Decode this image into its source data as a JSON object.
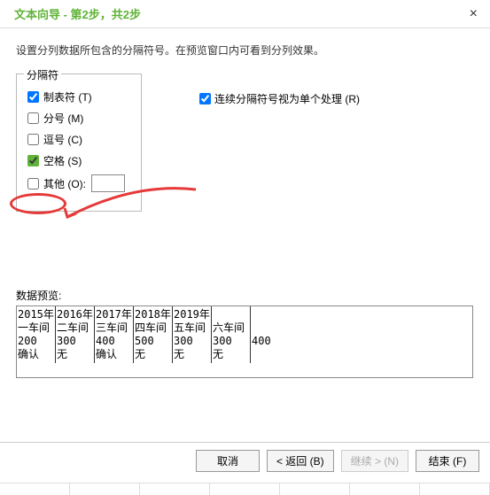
{
  "header": {
    "title": "文本向导 - 第2步，共2步",
    "close": "×"
  },
  "instruction": "设置分列数据所包含的分隔符号。在预览窗口内可看到分列效果。",
  "delimiters": {
    "legend": "分隔符",
    "tab": "制表符 (T)",
    "semicolon": "分号 (M)",
    "comma": "逗号 (C)",
    "space": "空格 (S)",
    "other": "其他 (O):"
  },
  "consecutive": "连续分隔符号视为单个处理 (R)",
  "preview_label": "数据预览:",
  "preview_cols": [
    "2015年\n一车间\n200\n确认",
    "2016年\n二车间\n300\n无",
    "2017年\n三车间\n400\n确认",
    "2018年\n四车间\n500\n无",
    "2019年\n五车间\n300\n无",
    "\n六车间\n300\n无",
    "\n\n400\n"
  ],
  "footer": {
    "cancel": "取消",
    "back": "< 返回 (B)",
    "next": "继续 > (N)",
    "finish": "结束 (F)"
  }
}
